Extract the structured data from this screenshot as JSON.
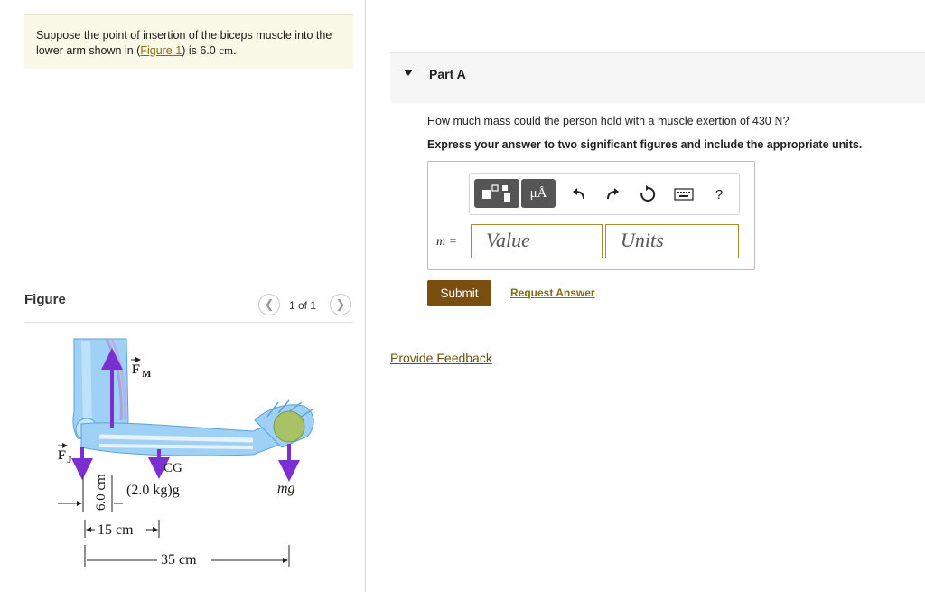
{
  "problem": {
    "text_before": "Suppose the point of insertion of the biceps muscle into the lower arm shown in (",
    "figure_link": "Figure 1",
    "text_after": ") is 6.0 ",
    "unit": "cm",
    "period": "."
  },
  "figure": {
    "label": "Figure",
    "prev_icon": "chevron-left-icon",
    "next_icon": "chevron-right-icon",
    "count": "1 of 1",
    "labels": {
      "fm_main": "F",
      "fm_sub": "M",
      "fj_main": "F",
      "fj_sub": "J",
      "cg": "CG",
      "cg_weight": "(2.0 kg)g",
      "mg": "mg",
      "dim_6": "6.0 cm",
      "dim_15": "15 cm",
      "dim_35": "35 cm"
    }
  },
  "part": {
    "title": "Part A",
    "caret_icon": "caret-down-icon"
  },
  "question": {
    "text_before": "How much mass could the person hold with a muscle exertion of 430 ",
    "unit": "N",
    "text_after": "?"
  },
  "instruction": "Express your answer to two significant figures and include the appropriate units.",
  "toolbar": {
    "templates_icon": "templates-icon",
    "units_label": "μÅ",
    "undo_icon": "undo-icon",
    "redo_icon": "redo-icon",
    "reset_icon": "reset-icon",
    "keyboard_icon": "keyboard-icon",
    "help_label": "?"
  },
  "answer": {
    "variable_label": "m =",
    "value_placeholder": "Value",
    "units_placeholder": "Units"
  },
  "actions": {
    "submit_label": "Submit",
    "request_answer_label": "Request Answer",
    "feedback_label": "Provide Feedback"
  },
  "colors": {
    "brand_brown": "#7a4d10",
    "link_gold": "#8b6a15",
    "input_border": "#b08a2a",
    "force_arrow": "#7b2fd1"
  }
}
